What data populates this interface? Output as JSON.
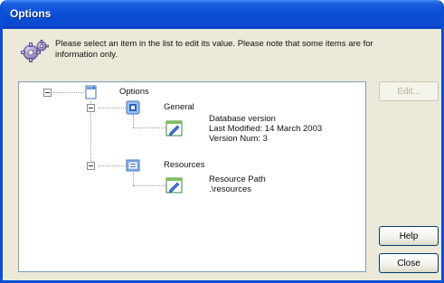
{
  "window": {
    "title": "Options"
  },
  "info": {
    "text": "Please select an item in the list to edit its value. Please note that some items are for information only."
  },
  "tree": {
    "root": {
      "label": "Options"
    },
    "general": {
      "label": "General",
      "details": [
        "Database version",
        "Last Modified: 14 March 2003",
        "Version Num: 3"
      ]
    },
    "resources": {
      "label": "Resources",
      "details": [
        "Resource Path",
        ".\\resources"
      ]
    }
  },
  "buttons": {
    "edit": "Edit...",
    "help": "Help",
    "close": "Close"
  },
  "colors": {
    "title_bar": "#0a4fd6",
    "window_bg": "#ece9d8",
    "panel_border": "#7f9db9"
  }
}
